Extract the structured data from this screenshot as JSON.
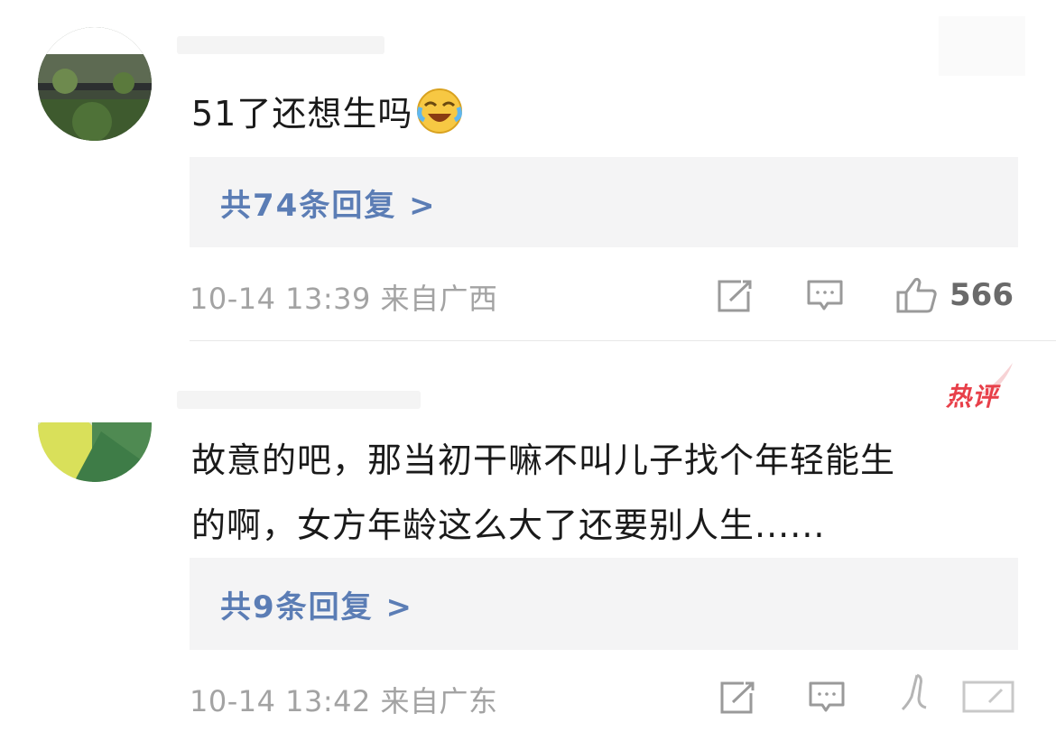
{
  "comments": [
    {
      "text": "51了还想生吗",
      "emoji": "laughing-crying-emoji",
      "replies_label": "共74条回复 >",
      "timestamp": "10-14 13:39",
      "location": "来自广西",
      "likes": "566"
    },
    {
      "hot_label": "热评",
      "text_line1": "故意的吧，那当初干嘛不叫儿子找个年轻能生",
      "text_line2": "的啊，女方年龄这么大了还要别人生......",
      "replies_label": "共9条回复 >",
      "timestamp": "10-14 13:42",
      "location": "来自广东"
    }
  ],
  "icons": {
    "share": "share-icon",
    "reply": "comment-icon",
    "like": "thumbs-up-icon"
  },
  "colors": {
    "link_blue": "#5b7db5",
    "meta_gray": "#a3a3a3",
    "reply_bg": "#f4f4f5",
    "hot_red": "#e8404a"
  }
}
